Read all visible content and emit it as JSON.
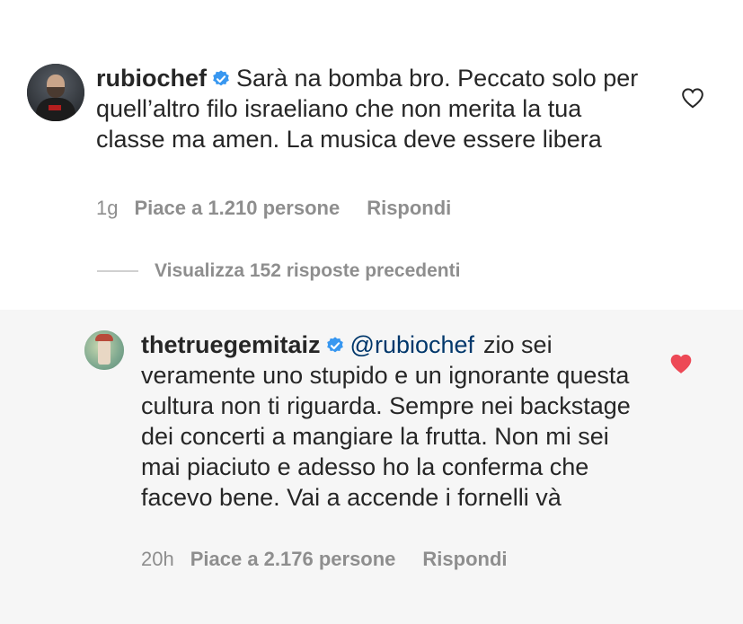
{
  "comment": {
    "username": "rubiochef",
    "verified": true,
    "text": "Sarà na bomba bro. Peccato solo per quell’altro filo israeliano che non merita la tua classe ma amen. La musica deve essere libera",
    "age": "1g",
    "likes_label": "Piace a 1.210 persone",
    "reply_label": "Rispondi",
    "liked": false,
    "heart_color": "#262626"
  },
  "replies_toggle": {
    "label": "Visualizza 152 risposte precedenti"
  },
  "reply": {
    "username": "thetruegemitaiz",
    "verified": true,
    "mention": "@rubiochef",
    "text": "zio sei veramente uno stupido e un ignorante questa cultura non ti riguarda. Sempre nei backstage dei concerti a mangiare la frutta. Non mi sei mai piaciuto e adesso ho la conferma che facevo bene. Vai a accende i fornelli và",
    "age": "20h",
    "likes_label": "Piace a 2.176 persone",
    "reply_label": "Rispondi",
    "liked": true,
    "heart_color": "#ed4956"
  },
  "colors": {
    "verified_badge": "#3897f0",
    "mention": "#00376b",
    "meta_text": "#8e8e8e",
    "reply_highlight_bg": "#f6f6f6"
  },
  "icons": {
    "verified": "verified-badge-icon",
    "heart_outline": "heart-outline-icon",
    "heart_filled": "heart-filled-icon"
  }
}
